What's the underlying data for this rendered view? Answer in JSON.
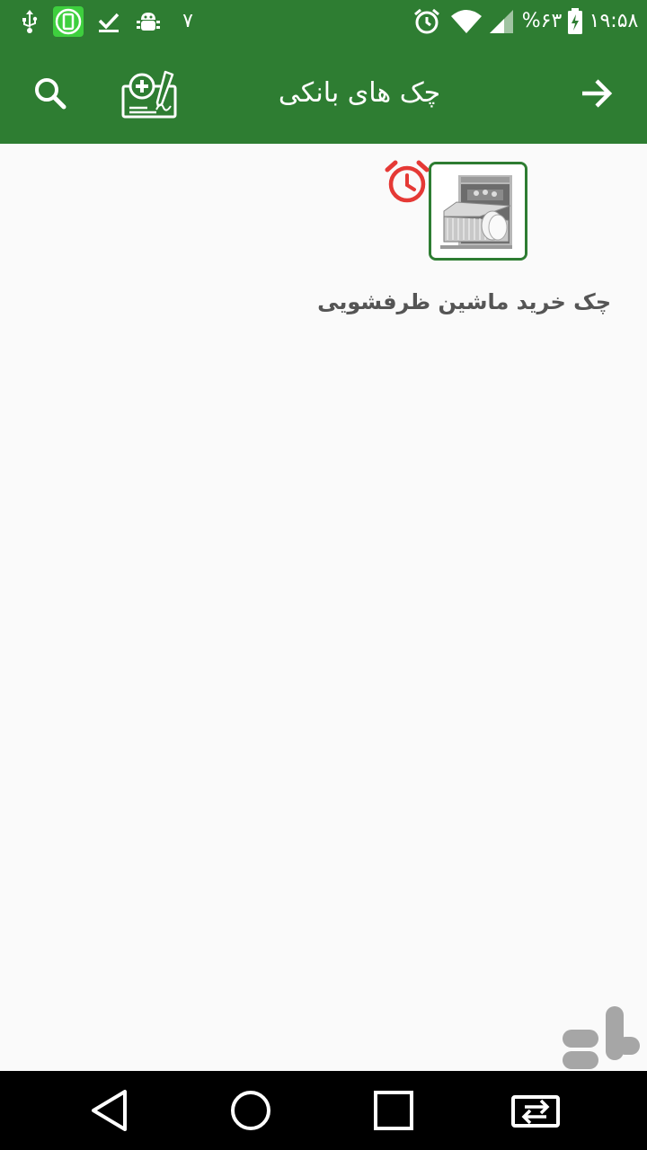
{
  "status_bar": {
    "time": "۱۹:۵۸",
    "battery_percent": "%۶۳",
    "notification_count": "۷"
  },
  "app_bar": {
    "title": "چک های بانکی"
  },
  "checks": [
    {
      "label": "چک خرید ماشین ظرفشویی",
      "has_reminder": true
    }
  ],
  "colors": {
    "primary": "#2e7d32",
    "alarm": "#e53935",
    "label_text": "#555555"
  }
}
